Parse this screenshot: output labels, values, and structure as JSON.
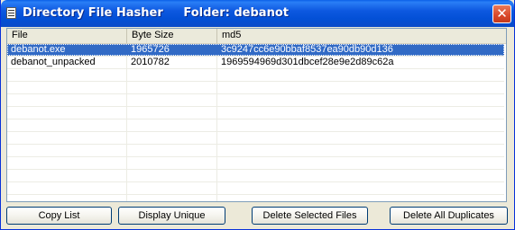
{
  "window": {
    "title": "Directory File Hasher     Folder: debanot",
    "close_glyph": "✕",
    "icon": "app-document-icon"
  },
  "table": {
    "columns": [
      "File",
      "Byte Size",
      "md5"
    ],
    "rows": [
      {
        "file": "debanot.exe",
        "size": "1965726",
        "md5": "3c9247cc6e90bbaf8537ea90db90d136",
        "selected": true
      },
      {
        "file": "debanot_unpacked",
        "size": "2010782",
        "md5": "1969594969d301dbcef28e9e2d89c62a",
        "selected": false
      }
    ]
  },
  "buttons": {
    "copy_list": "Copy List",
    "display_unique": "Display Unique",
    "delete_selected": "Delete Selected Files",
    "delete_duplicates": "Delete All Duplicates"
  },
  "colors": {
    "titlebar": "#0a56dc",
    "selection": "#316ac5",
    "close": "#d9482a",
    "face": "#ece9d8"
  }
}
